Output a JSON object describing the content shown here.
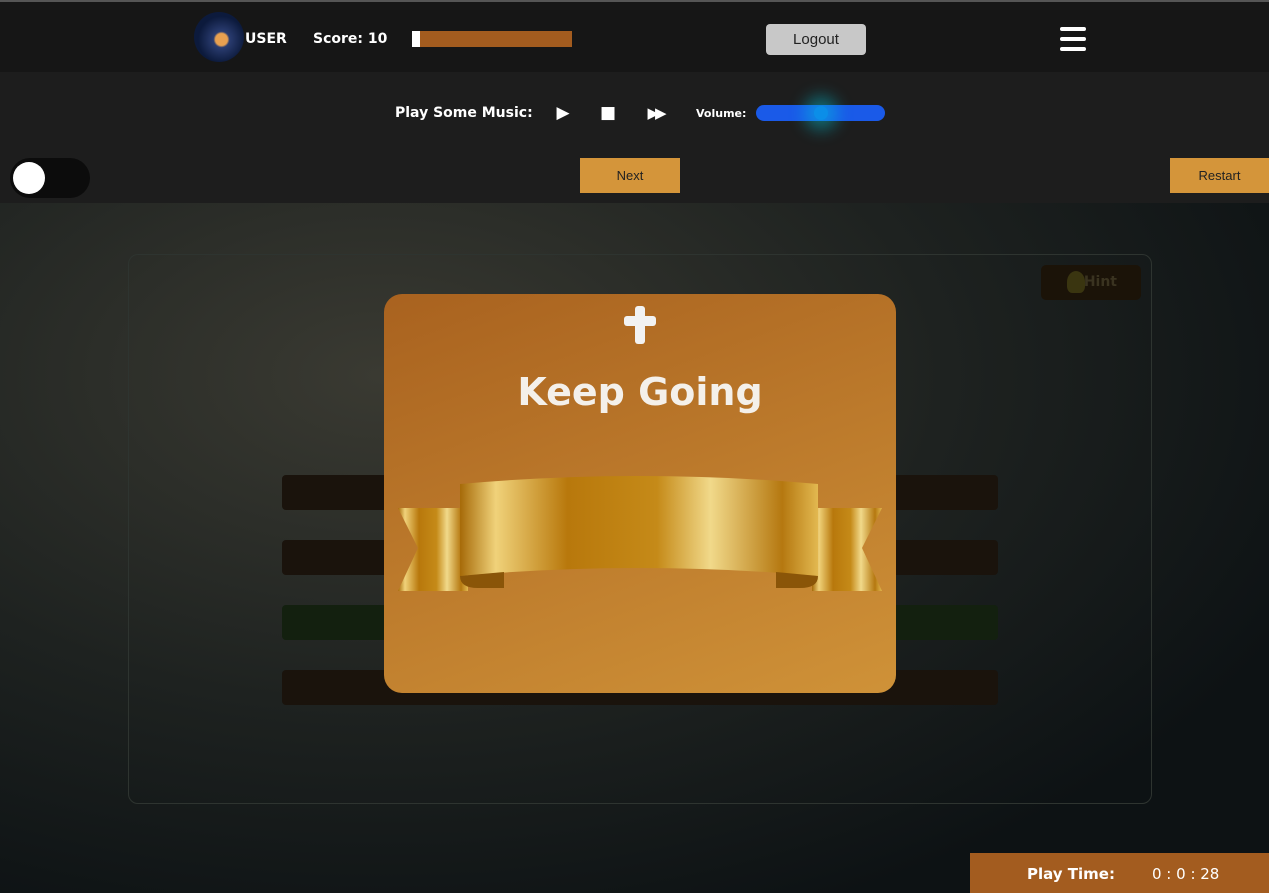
{
  "header": {
    "username": "USER",
    "score_label": "Score: 10",
    "progress_percent": 5,
    "logout_label": "Logout"
  },
  "music": {
    "label": "Play Some Music:",
    "play_icon": "play-icon",
    "stop_icon": "stop-icon",
    "forward_icon": "fast-forward-icon",
    "volume_label": "Volume:",
    "volume_percent": 50
  },
  "controls": {
    "next_label": "Next",
    "restart_label": "Restart",
    "toggle_on": false
  },
  "quiz": {
    "hint_label": "Hint"
  },
  "modal": {
    "title": "Keep Going"
  },
  "footer": {
    "play_time_label": "Play Time:",
    "play_time_value": "0 : 0 : 28"
  },
  "colors": {
    "accent": "#a35c1f",
    "button": "#d4953a",
    "volume": "#1a5ae8"
  }
}
